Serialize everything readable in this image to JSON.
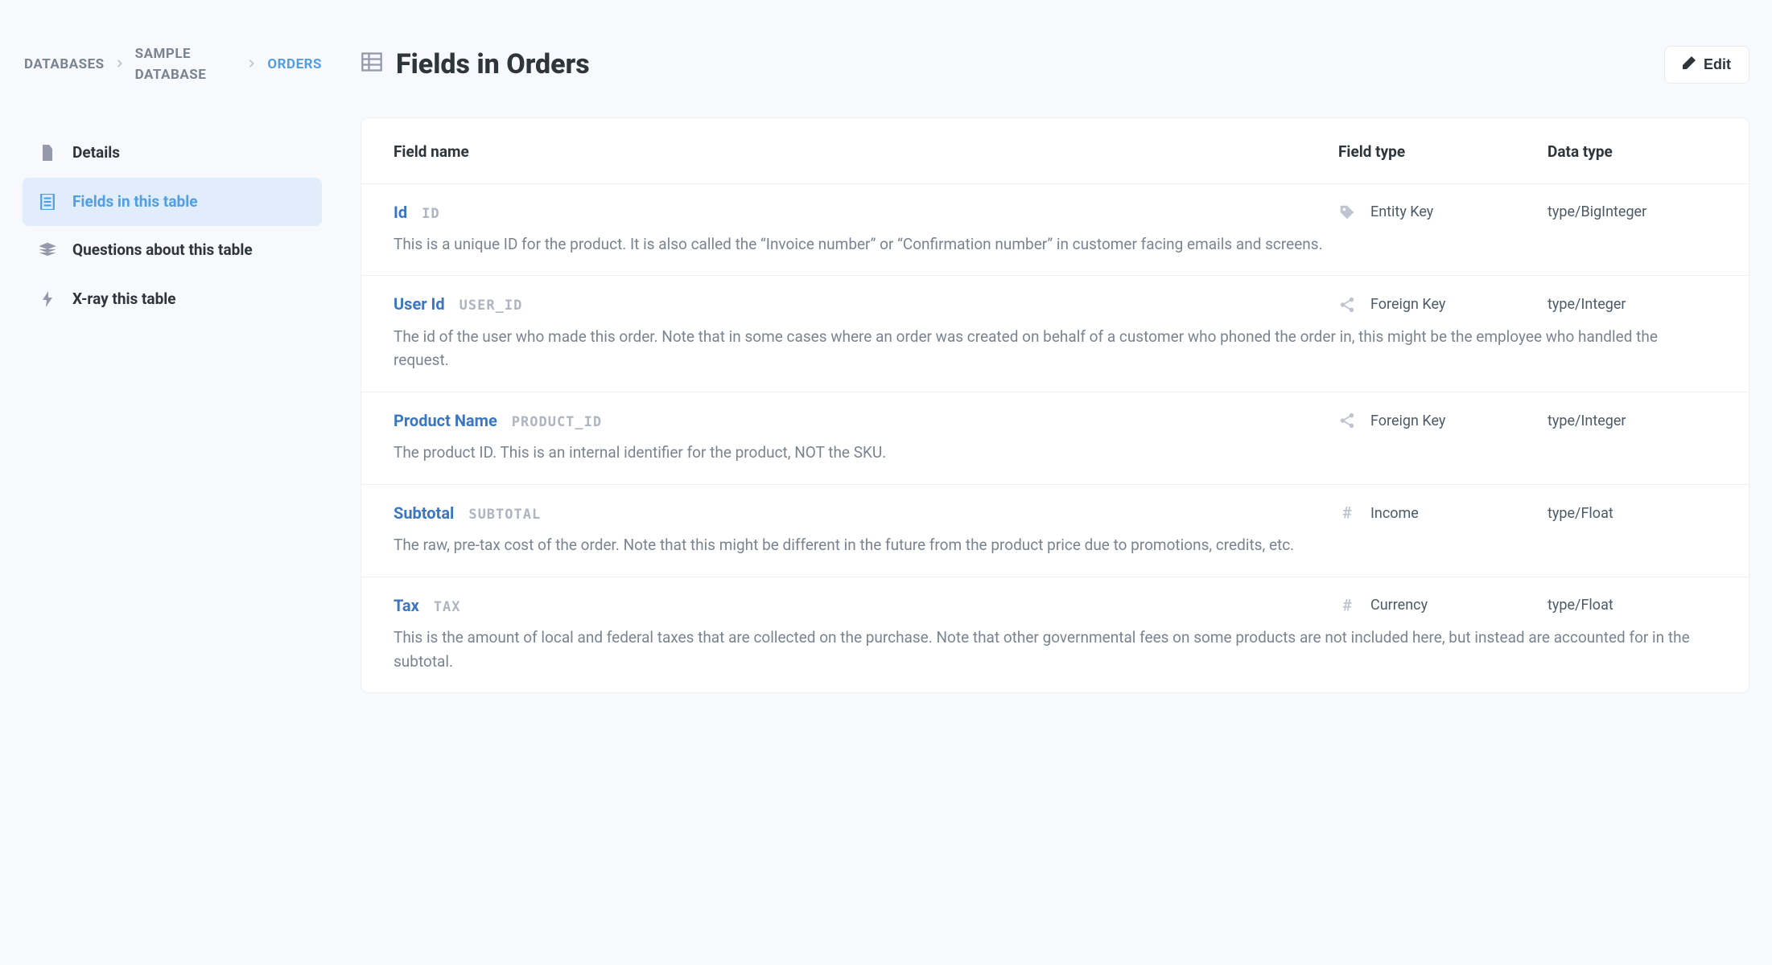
{
  "breadcrumb": [
    {
      "label": "DATABASES",
      "active": false
    },
    {
      "label": "SAMPLE DATABASE",
      "active": false
    },
    {
      "label": "ORDERS",
      "active": true
    }
  ],
  "sidebar": [
    {
      "label": "Details",
      "icon": "document",
      "active": false
    },
    {
      "label": "Fields in this table",
      "icon": "list",
      "active": true
    },
    {
      "label": "Questions about this table",
      "icon": "stack",
      "active": false
    },
    {
      "label": "X-ray this table",
      "icon": "bolt",
      "active": false
    }
  ],
  "page": {
    "title": "Fields in Orders",
    "edit_label": "Edit"
  },
  "columns": {
    "name": "Field name",
    "type": "Field type",
    "data": "Data type"
  },
  "fields": [
    {
      "name": "Id",
      "db_name": "ID",
      "type_icon": "tag",
      "field_type": "Entity Key",
      "data_type": "type/BigInteger",
      "description": "This is a unique ID for the product. It is also called the “Invoice number” or “Confirmation number” in customer facing emails and screens."
    },
    {
      "name": "User Id",
      "db_name": "USER_ID",
      "type_icon": "share",
      "field_type": "Foreign Key",
      "data_type": "type/Integer",
      "description": "The id of the user who made this order. Note that in some cases where an order was created on behalf of a customer who phoned the order in, this might be the employee who handled the request."
    },
    {
      "name": "Product Name",
      "db_name": "PRODUCT_ID",
      "type_icon": "share",
      "field_type": "Foreign Key",
      "data_type": "type/Integer",
      "description": "The product ID. This is an internal identifier for the product, NOT the SKU."
    },
    {
      "name": "Subtotal",
      "db_name": "SUBTOTAL",
      "type_icon": "hash",
      "field_type": "Income",
      "data_type": "type/Float",
      "description": "The raw, pre-tax cost of the order. Note that this might be different in the future from the product price due to promotions, credits, etc."
    },
    {
      "name": "Tax",
      "db_name": "TAX",
      "type_icon": "hash",
      "field_type": "Currency",
      "data_type": "type/Float",
      "description": "This is the amount of local and federal taxes that are collected on the purchase. Note that other governmental fees on some products are not included here, but instead are accounted for in the subtotal."
    }
  ]
}
